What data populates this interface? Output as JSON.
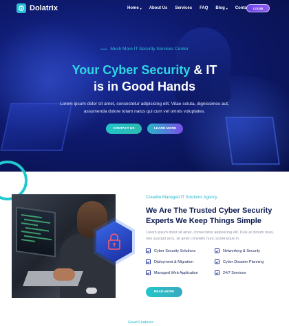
{
  "brand": {
    "name": "Dolatrix"
  },
  "nav": {
    "items": [
      {
        "label": "Home",
        "has_dropdown": true
      },
      {
        "label": "About Us",
        "has_dropdown": false
      },
      {
        "label": "Services",
        "has_dropdown": false
      },
      {
        "label": "FAQ",
        "has_dropdown": false
      },
      {
        "label": "Blog",
        "has_dropdown": true
      },
      {
        "label": "Contact",
        "has_dropdown": false
      }
    ],
    "login_label": "LOGIN",
    "dropdown_glyph": "▾"
  },
  "hero": {
    "tagline": "Much More IT Security Services Center",
    "headline_accent": "Your Cyber Security",
    "headline_rest_1": "& IT",
    "headline_line_2": "is in Good Hands",
    "lede": "Lorem ipsum dolor sit amet, consectetur adipisicing elit. Vitae soluta, dignissimos aut, assumenda dolore totam natus qui cum vel omnis voluptates.",
    "contact_label": "CONTACT US",
    "learn_label": "LEARN MORE"
  },
  "about": {
    "kicker": "Creative Managed IT Solutions Agency",
    "title": "We Are The Trusted Cyber Security Experts We Keep Things Simple",
    "text": "Lorem ipsum dolor sit amet, consectetur adipisicing elit. Duis at dictum risus, non suscipit arcu. sit amet convallis nunc scelerisque in.",
    "features": [
      "Cyber Security Solutions",
      "Networking & Security",
      "Diployment & Migration",
      "Cyber Disaster Planning",
      "Managed Web Application",
      "24/7 Services"
    ],
    "more_label": "READ MORE"
  },
  "next_section": {
    "kicker": "Great Features"
  },
  "colors": {
    "accent": "#2fd6e0",
    "navy": "#0b1950",
    "purple": "#7b4ee8"
  }
}
